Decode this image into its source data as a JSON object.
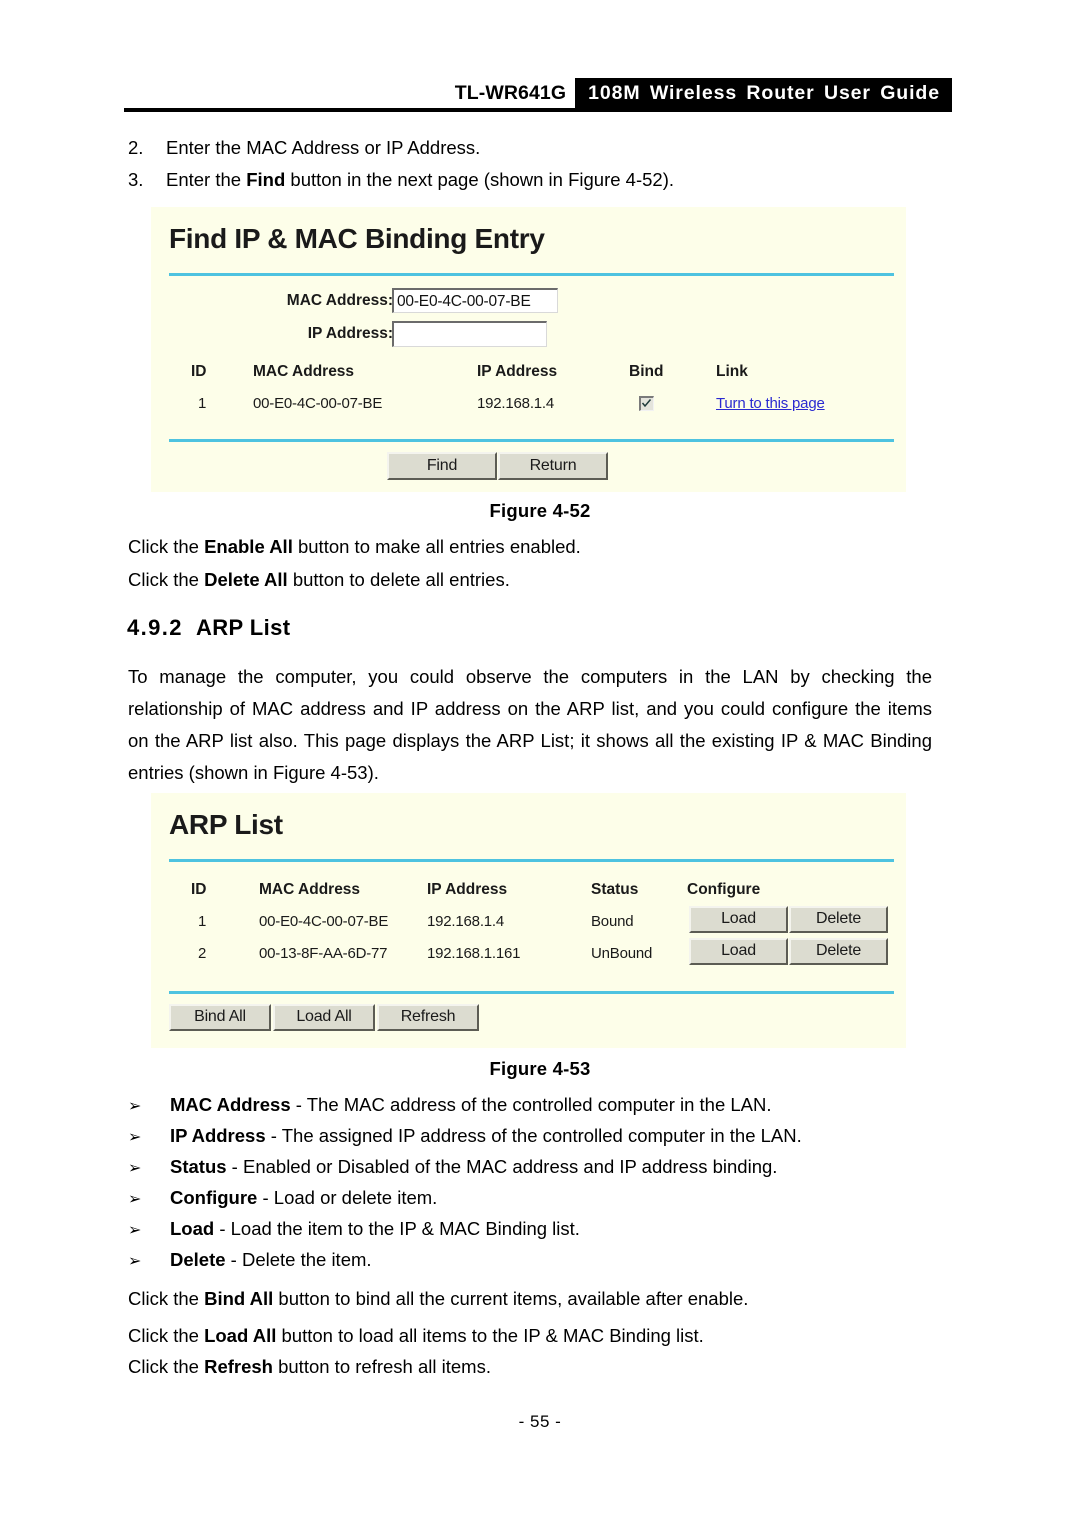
{
  "header": {
    "model": "TL-WR641G",
    "band_title": "108M Wireless Router User Guide"
  },
  "steps": [
    {
      "num": "2.",
      "text": "Enter the MAC Address or IP Address."
    },
    {
      "num": "3.",
      "pre": "Enter the ",
      "bold": "Find",
      "post": " button in the next page (shown in Figure 4-52)."
    }
  ],
  "figure_52": {
    "title": "Find IP & MAC Binding Entry",
    "caption": "Figure 4-52",
    "form": {
      "mac_label": "MAC Address:",
      "mac_value": "00-E0-4C-00-07-BE",
      "ip_label": "IP Address:",
      "ip_value": ""
    },
    "columns": [
      "ID",
      "MAC Address",
      "IP Address",
      "Bind",
      "Link"
    ],
    "rows": [
      {
        "id": "1",
        "mac": "00-E0-4C-00-07-BE",
        "ip": "192.168.1.4",
        "bind_checked": true,
        "link": "Turn to this page"
      }
    ],
    "buttons": [
      "Find",
      "Return"
    ]
  },
  "after_fig52": [
    {
      "pre": "Click the ",
      "bold": "Enable All",
      "post": " button to make all entries enabled."
    },
    {
      "pre": "Click the ",
      "bold": "Delete All",
      "post": " button to delete all entries."
    }
  ],
  "section": {
    "number": "4.9.2",
    "title": "ARP List"
  },
  "intro_paragraph": {
    "line1": "To manage the computer, you could observe the computers in the LAN by checking the",
    "line2": "relationship of MAC address and IP address on the ARP list, and you could configure the items",
    "line3": "on the ARP list also. This page displays the ARP List; it shows all the existing IP & MAC Binding",
    "line4": "entries (shown in Figure 4-53)."
  },
  "figure_53": {
    "title": "ARP List",
    "caption": "Figure 4-53",
    "columns": [
      "ID",
      "MAC Address",
      "IP Address",
      "Status",
      "Configure"
    ],
    "rows": [
      {
        "id": "1",
        "mac": "00-E0-4C-00-07-BE",
        "ip": "192.168.1.4",
        "status": "Bound",
        "load": "Load",
        "delete": "Delete"
      },
      {
        "id": "2",
        "mac": "00-13-8F-AA-6D-77",
        "ip": "192.168.1.161",
        "status": "UnBound",
        "load": "Load",
        "delete": "Delete"
      }
    ],
    "buttons": [
      "Bind All",
      "Load All",
      "Refresh"
    ]
  },
  "definitions": [
    {
      "arrow": "➢",
      "bold": "MAC Address",
      "rest": " - The MAC address of the controlled computer in the LAN."
    },
    {
      "arrow": "➢",
      "bold": "IP Address",
      "rest": " - The assigned IP address of the controlled computer in the LAN."
    },
    {
      "arrow": "➢",
      "bold": "Status",
      "rest": " - Enabled or Disabled of the MAC address and IP address binding."
    },
    {
      "arrow": "➢",
      "bold": "Configure",
      "rest": " - Load or delete item."
    },
    {
      "arrow": "➢",
      "bold": "Load",
      "rest": " - Load the item to the IP & MAC Binding list."
    },
    {
      "arrow": "➢",
      "bold": "Delete",
      "rest": " - Delete the item."
    }
  ],
  "after_fig53": [
    {
      "pre": "Click the ",
      "bold": "Bind All",
      "post": " button to bind all the current items, available after enable."
    },
    {
      "pre": "Click the ",
      "bold": "Load All",
      "post": " button to load all items to the IP & MAC Binding list."
    },
    {
      "pre": "Click the ",
      "bold": "Refresh",
      "post": " button to refresh all items."
    }
  ],
  "page_number": "- 55 -",
  "colors": {
    "figure_background": "#fdfee9",
    "divider": "#4ec3e0",
    "link": "#2a2ad0",
    "button_face": "#dcdcd0",
    "header_band": "#000000"
  }
}
